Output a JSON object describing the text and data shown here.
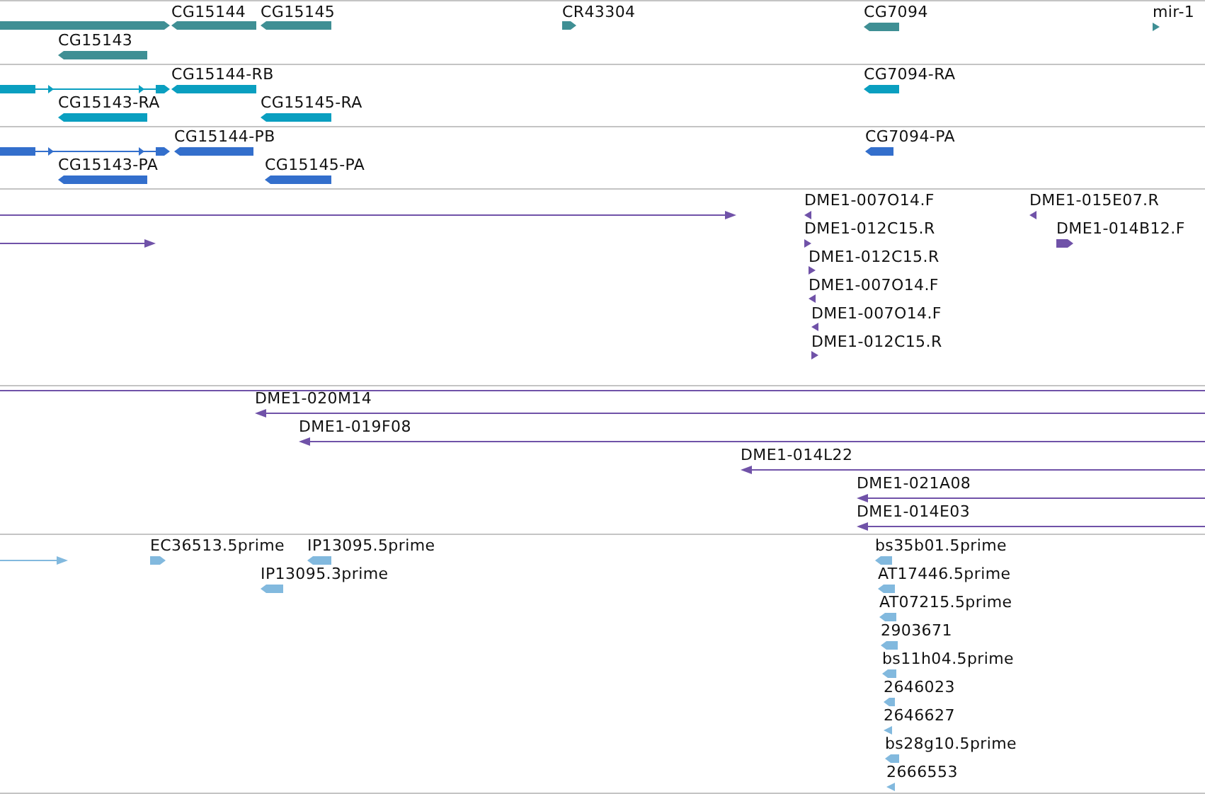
{
  "tracks": [
    {
      "color": "#3f8f94",
      "features": [
        {
          "kind": "bar",
          "reverse": false
        },
        {
          "kind": "bar",
          "reverse": true,
          "label": "CG15144"
        },
        {
          "kind": "bar",
          "reverse": true,
          "label": "CG15145"
        },
        {
          "kind": "bar",
          "reverse": false,
          "label": "CR43304"
        },
        {
          "kind": "bar",
          "reverse": true,
          "label": "CG7094"
        },
        {
          "kind": "bar",
          "reverse": false,
          "label": "mir-1"
        },
        {
          "kind": "bar",
          "reverse": true,
          "label": "CG15143"
        }
      ]
    },
    {
      "color": "#0a9fc0",
      "features": [
        {
          "kind": "gene-model",
          "reverse": false
        },
        {
          "kind": "bar",
          "reverse": true,
          "label": "CG15144-RB"
        },
        {
          "kind": "bar",
          "reverse": true,
          "label": "CG7094-RA"
        },
        {
          "kind": "bar",
          "reverse": true,
          "label": "CG15143-RA"
        },
        {
          "kind": "bar",
          "reverse": true,
          "label": "CG15145-RA"
        }
      ]
    },
    {
      "color": "#336fcc",
      "features": [
        {
          "kind": "gene-model",
          "reverse": false
        },
        {
          "kind": "bar",
          "reverse": true,
          "label": "CG15144-PB"
        },
        {
          "kind": "bar",
          "reverse": true,
          "label": "CG7094-PA"
        },
        {
          "kind": "bar",
          "reverse": true,
          "label": "CG15143-PA"
        },
        {
          "kind": "bar",
          "reverse": true,
          "label": "CG15145-PA"
        }
      ]
    },
    {
      "color": "#7052a8",
      "features": [
        {
          "kind": "line",
          "reverse": false
        },
        {
          "kind": "line",
          "reverse": false
        },
        {
          "kind": "bar",
          "reverse": true,
          "label": "DME1-007O14.F"
        },
        {
          "kind": "bar",
          "reverse": false,
          "label": "DME1-012C15.R"
        },
        {
          "kind": "bar",
          "reverse": false,
          "label": "DME1-012C15.R"
        },
        {
          "kind": "bar",
          "reverse": true,
          "label": "DME1-007O14.F"
        },
        {
          "kind": "bar",
          "reverse": true,
          "label": "DME1-007O14.F"
        },
        {
          "kind": "bar",
          "reverse": false,
          "label": "DME1-012C15.R"
        },
        {
          "kind": "bar",
          "reverse": true,
          "label": "DME1-015E07.R"
        },
        {
          "kind": "bar",
          "reverse": false,
          "label": "DME1-014B12.F"
        }
      ]
    },
    {
      "color": "#7052a8",
      "features": [
        {
          "kind": "line",
          "reverse": true
        },
        {
          "kind": "line",
          "reverse": true,
          "label": "DME1-020M14"
        },
        {
          "kind": "line",
          "reverse": true,
          "label": "DME1-019F08"
        },
        {
          "kind": "line",
          "reverse": true,
          "label": "DME1-014L22"
        },
        {
          "kind": "line",
          "reverse": true,
          "label": "DME1-021A08"
        },
        {
          "kind": "line",
          "reverse": true,
          "label": "DME1-014E03"
        }
      ]
    },
    {
      "color": "#82b9de",
      "features": [
        {
          "kind": "line",
          "reverse": false
        },
        {
          "kind": "bar",
          "reverse": false,
          "label": "EC36513.5prime"
        },
        {
          "kind": "bar",
          "reverse": true,
          "label": "IP13095.5prime"
        },
        {
          "kind": "bar",
          "reverse": true,
          "label": "IP13095.3prime"
        },
        {
          "kind": "bar",
          "reverse": true,
          "label": "bs35b01.5prime"
        },
        {
          "kind": "bar",
          "reverse": true,
          "label": "AT17446.5prime"
        },
        {
          "kind": "bar",
          "reverse": true,
          "label": "AT07215.5prime"
        },
        {
          "kind": "bar",
          "reverse": true,
          "label": "2903671"
        },
        {
          "kind": "bar",
          "reverse": true,
          "label": "bs11h04.5prime"
        },
        {
          "kind": "bar",
          "reverse": true,
          "label": "2646023"
        },
        {
          "kind": "bar",
          "reverse": true,
          "label": "2646627"
        },
        {
          "kind": "bar",
          "reverse": true,
          "label": "bs28g10.5prime"
        },
        {
          "kind": "bar",
          "reverse": true,
          "label": "2666553"
        }
      ]
    }
  ]
}
